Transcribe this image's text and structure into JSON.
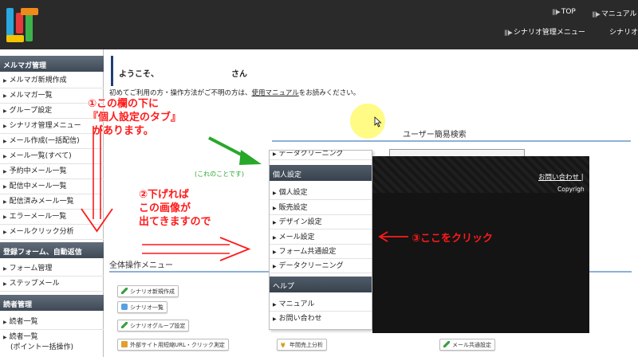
{
  "header": {
    "top_link": "TOP",
    "manual_link": "マニュアル",
    "scenario_menu_link": "シナリオ管理メニュー",
    "scenario_link_cut": "シナリオ"
  },
  "sidebar": {
    "section1": "メルマガ管理",
    "items1": [
      "メルマガ新規作成",
      "メルマガ一覧",
      "グループ設定",
      "シナリオ管理メニュー",
      "メール作成(一括配信)",
      "メール一覧(すべて)",
      "予約中メール一覧",
      "配信中メール一覧",
      "配信済みメール一覧",
      "エラーメール一覧",
      "メールクリック分析"
    ],
    "section2": "登録フォーム、自動返信",
    "items2": [
      "フォーム管理",
      "ステップメール"
    ],
    "section3": "読者管理",
    "items3": [
      "読者一覧",
      "読者一覧"
    ],
    "items3_sub": "(ポイント一括操作)"
  },
  "main": {
    "welcome": "ようこそ、",
    "san": "さん",
    "intro_before": "初めてご利用の方・操作方法がご不明の方は、",
    "intro_link": "使用マニュアル",
    "intro_after": "をお読みください。",
    "user_search_title": "ユーザー簡易検索",
    "bulk_menu_title": "全体操作メニュー",
    "buttons": [
      "シナリオ新規作成",
      "シナリオ一覧",
      "シナリオグループ設定",
      "外部サイト用短縮URL・クリック測定",
      "年間売上分析",
      "メール共通設定"
    ]
  },
  "popup": {
    "partial_top": "データクリーニング",
    "personal_settings": "個人設定",
    "items": [
      "個人設定",
      "販売設定",
      "デザイン設定",
      "メール設定",
      "フォーム共通設定",
      "データクリーニング"
    ],
    "help": "ヘルプ",
    "help_items": [
      "マニュアル",
      "お問い合わせ"
    ],
    "contact_link": "お問い合わせ |",
    "copyright_cut": "Copyrigh"
  },
  "annotations": {
    "note1_line1": "①この欄の下に",
    "note1_line2": "『個人設定のタブ』",
    "note1_line3": "があります。",
    "note2_line1": "②下げれば",
    "note2_line2": "この画像が",
    "note2_line3": "出てきますので",
    "note3": "③ここをクリック",
    "green_note": "(これのことです)"
  },
  "colors": {
    "header_bg": "#2a2a2a",
    "sidebar_head": "#4a5562",
    "annotation_red": "#ff1a1a",
    "annotation_green": "#27a82a",
    "accent_navy": "#1f3f73"
  }
}
